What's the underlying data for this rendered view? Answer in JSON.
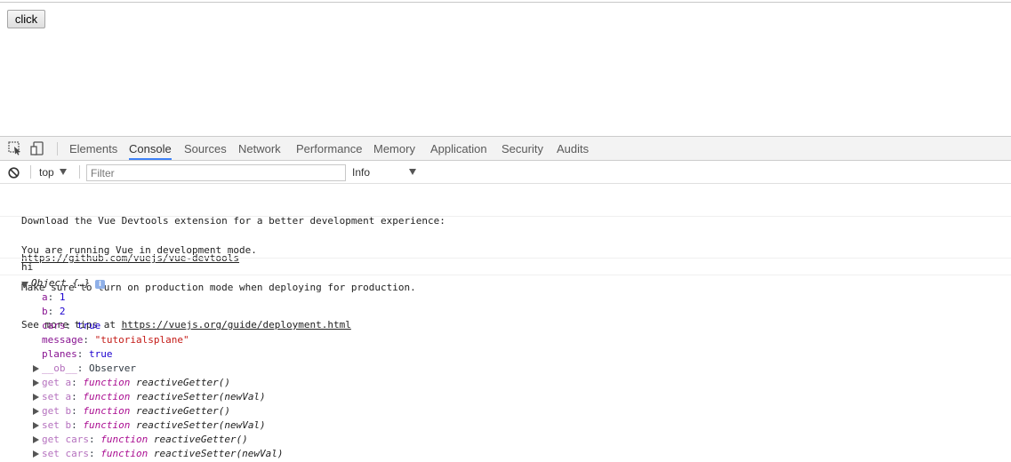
{
  "page": {
    "button_label": "click"
  },
  "devtools": {
    "tabs": [
      {
        "label": "Elements"
      },
      {
        "label": "Console"
      },
      {
        "label": "Sources"
      },
      {
        "label": "Network"
      },
      {
        "label": "Performance"
      },
      {
        "label": "Memory"
      },
      {
        "label": "Application"
      },
      {
        "label": "Security"
      },
      {
        "label": "Audits"
      }
    ],
    "active_tab": "Console",
    "icons": {
      "inspect": "inspect-element-icon",
      "device": "device-toolbar-icon",
      "clear": "clear-console-icon",
      "info": "info-icon"
    }
  },
  "filterbar": {
    "context": "top",
    "filter_placeholder": "Filter",
    "level": "Info"
  },
  "console": {
    "msg1": {
      "line1": "Download the Vue Devtools extension for a better development experience:",
      "link": "https://github.com/vuejs/vue-devtools"
    },
    "msg2": {
      "line1": "You are running Vue in development mode.",
      "line2": "Make sure to turn on production mode when deploying for production.",
      "line3_prefix": "See more tips at ",
      "link": "https://vuejs.org/guide/deployment.html"
    },
    "msg3": "hi",
    "object": {
      "summary": "Object {…}",
      "info_badge": "i",
      "props": [
        {
          "key": "a",
          "value": "1",
          "type": "num"
        },
        {
          "key": "b",
          "value": "2",
          "type": "num"
        },
        {
          "key": "cars",
          "value": "true",
          "type": "bool"
        },
        {
          "key": "message",
          "value": "\"tutorialsplane\"",
          "type": "str"
        },
        {
          "key": "planes",
          "value": "true",
          "type": "bool"
        }
      ],
      "observer": {
        "key": "__ob__",
        "value": "Observer"
      },
      "accessors": [
        {
          "key": "get a",
          "kw": "function",
          "fn": "reactiveGetter()"
        },
        {
          "key": "set a",
          "kw": "function",
          "fn": "reactiveSetter(newVal)"
        },
        {
          "key": "get b",
          "kw": "function",
          "fn": "reactiveGetter()"
        },
        {
          "key": "set b",
          "kw": "function",
          "fn": "reactiveSetter(newVal)"
        },
        {
          "key": "get cars",
          "kw": "function",
          "fn": "reactiveGetter()"
        },
        {
          "key": "set cars",
          "kw": "function",
          "fn": "reactiveSetter(newVal)"
        }
      ]
    }
  }
}
